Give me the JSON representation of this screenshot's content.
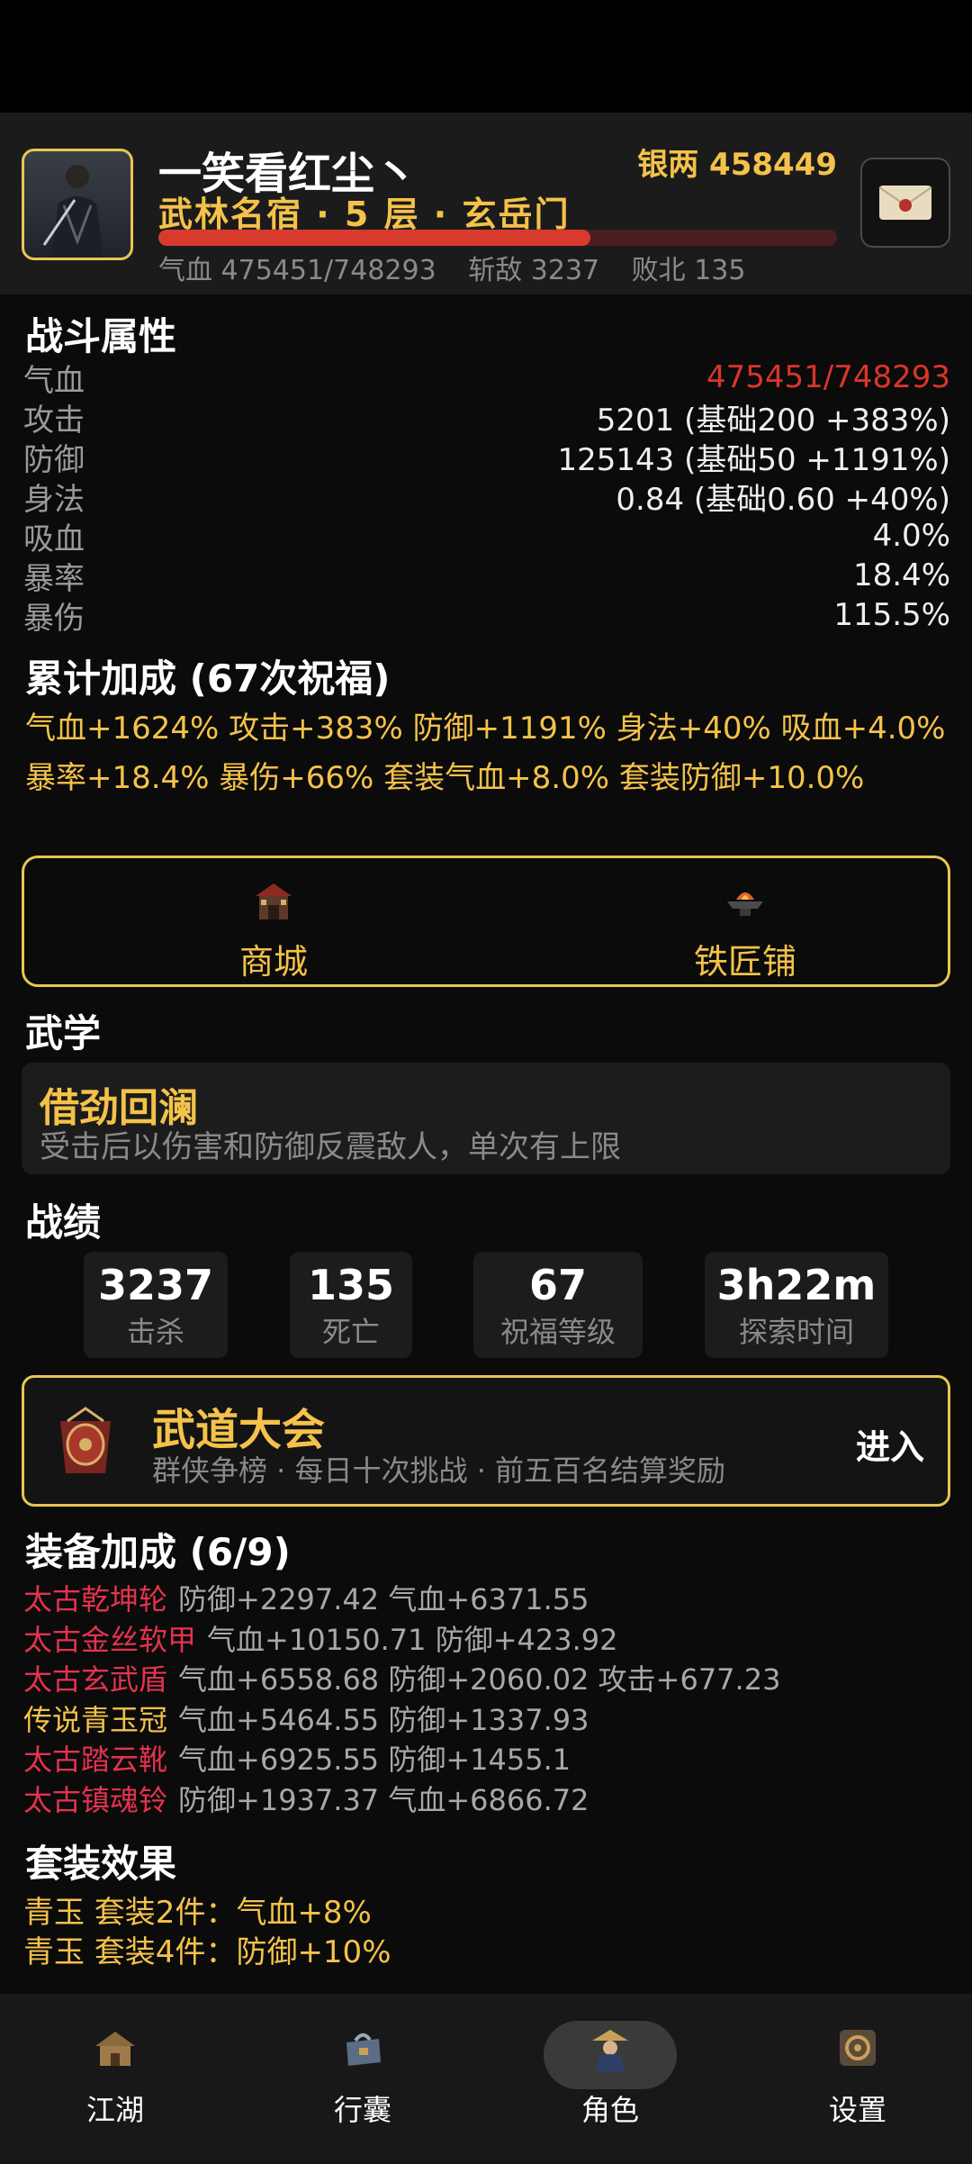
{
  "colors": {
    "gold": "#f4c24a",
    "red": "#d9352b",
    "ancient": "#e4334e",
    "bg": "#0b0b0b"
  },
  "header": {
    "name": "一笑看红尘丶",
    "silver": "银两 458449",
    "rank": "武林名宿 · 5 层 · 玄岳门",
    "hp_fraction": 0.636,
    "stats": [
      "气血 475451/748293",
      "斩敌 3237",
      "败北 135"
    ]
  },
  "combat": {
    "title": "战斗属性",
    "rows": [
      {
        "label": "气血",
        "value": "475451/748293"
      },
      {
        "label": "攻击",
        "value": "5201 (基础200 +383%)"
      },
      {
        "label": "防御",
        "value": "125143 (基础50 +1191%)"
      },
      {
        "label": "身法",
        "value": "0.84 (基础0.60 +40%)"
      },
      {
        "label": "吸血",
        "value": "4.0%"
      },
      {
        "label": "暴率",
        "value": "18.4%"
      },
      {
        "label": "暴伤",
        "value": "115.5%"
      }
    ]
  },
  "bonus": {
    "title": "累计加成 (67次祝福)",
    "text": "气血+1624% 攻击+383% 防御+1191% 身法+40% 吸血+4.0% 暴率+18.4% 暴伤+66% 套装气血+8.0% 套装防御+10.0%"
  },
  "shops": [
    {
      "label": "商城",
      "icon": "shop-icon"
    },
    {
      "label": "铁匠铺",
      "icon": "anvil-icon"
    }
  ],
  "martial": {
    "title": "武学",
    "skill_name": "借劲回澜",
    "skill_desc": "受击后以伤害和防御反震敌人，单次有上限"
  },
  "record": {
    "title": "战绩",
    "items": [
      {
        "value": "3237",
        "label": "击杀"
      },
      {
        "value": "135",
        "label": "死亡"
      },
      {
        "value": "67",
        "label": "祝福等级"
      },
      {
        "value": "3h22m",
        "label": "探索时间"
      }
    ]
  },
  "arena": {
    "title": "武道大会",
    "subtitle": "群侠争榜 · 每日十次挑战 · 前五百名结算奖励",
    "enter": "进入"
  },
  "equipment": {
    "title": "装备加成 (6/9)",
    "items": [
      {
        "name": "太古乾坤轮",
        "tier": "ancient",
        "bonus": "防御+2297.42 气血+6371.55"
      },
      {
        "name": "太古金丝软甲",
        "tier": "ancient",
        "bonus": "气血+10150.71 防御+423.92"
      },
      {
        "name": "太古玄武盾",
        "tier": "ancient",
        "bonus": "气血+6558.68 防御+2060.02 攻击+677.23"
      },
      {
        "name": "传说青玉冠",
        "tier": "legend",
        "bonus": "气血+5464.55 防御+1337.93"
      },
      {
        "name": "太古踏云靴",
        "tier": "ancient",
        "bonus": "气血+6925.55 防御+1455.1"
      },
      {
        "name": "太古镇魂铃",
        "tier": "ancient",
        "bonus": "防御+1937.37 气血+6866.72"
      }
    ]
  },
  "sets": {
    "title": "套装效果",
    "items": [
      "青玉 套装2件：气血+8%",
      "青玉 套装4件：防御+10%"
    ]
  },
  "tabs": [
    {
      "label": "江湖",
      "icon": "village-icon"
    },
    {
      "label": "行囊",
      "icon": "bag-icon"
    },
    {
      "label": "角色",
      "icon": "character-icon",
      "active": true
    },
    {
      "label": "设置",
      "icon": "settings-icon"
    }
  ]
}
